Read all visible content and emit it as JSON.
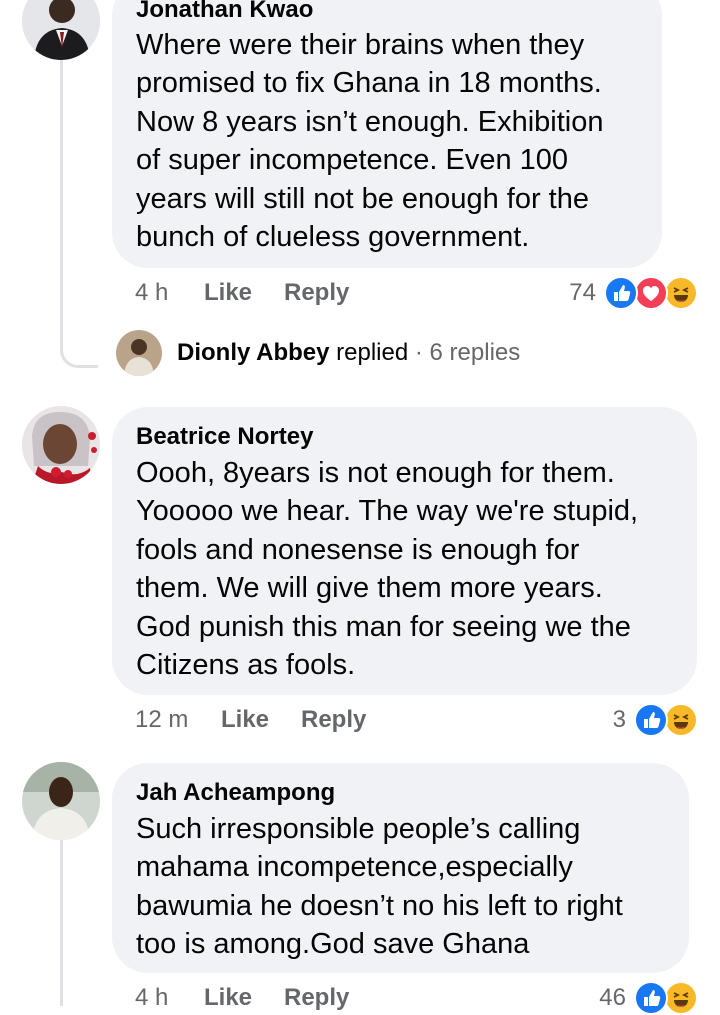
{
  "colors": {
    "bubble": "#f0f2f5",
    "text": "#050505",
    "muted": "#65676b",
    "thread_line": "#dfe1e5",
    "like_blue": "#1877f2",
    "love_red": "#f33e58",
    "haha_yellow": "#f7b928"
  },
  "comments": [
    {
      "author": "Jonathan Kwao",
      "text": "Where were their brains when they\npromised to fix Ghana in 18 months.\nNow 8 years isn’t enough. Exhibition\nof super incompetence. Even 100\nyears will still not be enough for the\nbunch of clueless government.",
      "time": "4 h",
      "like_label": "Like",
      "reply_label": "Reply",
      "reaction_count": "74",
      "reactions": [
        "like-icon",
        "love-icon",
        "haha-icon"
      ],
      "reply_summary": {
        "name": "Dionly Abbey",
        "action": "replied",
        "separator": "·",
        "count_text": "6 replies"
      }
    },
    {
      "author": "Beatrice Nortey",
      "text": "Oooh, 8years is not enough for them.\nYooooo we hear. The way we're stupid,\nfools and nonesense is enough for\nthem. We will give them more years.\nGod punish this man for seeing we the\nCitizens as fools.",
      "time": "12 m",
      "like_label": "Like",
      "reply_label": "Reply",
      "reaction_count": "3",
      "reactions": [
        "like-icon",
        "haha-icon"
      ]
    },
    {
      "author": "Jah Acheampong",
      "text": "Such irresponsible people’s calling\nmahama incompetence,especially\nbawumia he doesn’t no his left to right\ntoo is among.God save Ghana",
      "time": "4 h",
      "like_label": "Like",
      "reply_label": "Reply",
      "reaction_count": "46",
      "reactions": [
        "like-icon",
        "haha-icon"
      ]
    }
  ]
}
